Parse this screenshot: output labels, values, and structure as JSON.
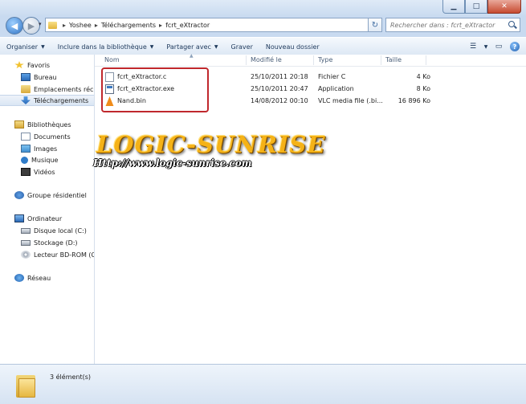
{
  "window": {
    "controls": {
      "minimize": "▁",
      "maximize": "□",
      "close": "✕"
    }
  },
  "address": {
    "crumbs": [
      "Yoshee",
      "Téléchargements",
      "fcrt_eXtractor"
    ],
    "separator": "▸",
    "search_placeholder": "Rechercher dans : fcrt_eXtractor"
  },
  "toolbar": {
    "organiser": "Organiser",
    "inclure": "Inclure dans la bibliothèque",
    "partager": "Partager avec",
    "graver": "Graver",
    "nouveau_dossier": "Nouveau dossier"
  },
  "nav": {
    "favoris": "Favoris",
    "bureau": "Bureau",
    "emplacements": "Emplacements récents",
    "telechargements": "Téléchargements",
    "bibliotheques": "Bibliothèques",
    "documents": "Documents",
    "images": "Images",
    "musique": "Musique",
    "videos": "Vidéos",
    "groupe": "Groupe résidentiel",
    "ordinateur": "Ordinateur",
    "disque_c": "Disque local (C:)",
    "stockage_d": "Stockage (D:)",
    "lecteur_bd": "Lecteur BD-ROM (G:)",
    "reseau": "Réseau"
  },
  "columns": {
    "nom": "Nom",
    "modifie": "Modifié le",
    "type": "Type",
    "taille": "Taille"
  },
  "files": [
    {
      "name": "fcrt_eXtractor.c",
      "modified": "25/10/2011 20:18",
      "type": "Fichier C",
      "size": "4 Ko",
      "icon": "c-source-file-icon"
    },
    {
      "name": "fcrt_eXtractor.exe",
      "modified": "25/10/2011 20:47",
      "type": "Application",
      "size": "8 Ko",
      "icon": "exe-file-icon"
    },
    {
      "name": "Nand.bin",
      "modified": "14/08/2012 00:10",
      "type": "VLC media file (.bi...",
      "size": "16 896 Ko",
      "icon": "vlc-cone-icon"
    }
  ],
  "watermark": {
    "title": "LOGIC-SUNRISE",
    "url": "Http://www.logic-sunrise.com"
  },
  "status": {
    "count": "3 élément(s)"
  },
  "colors": {
    "highlight_box": "#c0282d",
    "watermark_gold": "#f5b217"
  }
}
